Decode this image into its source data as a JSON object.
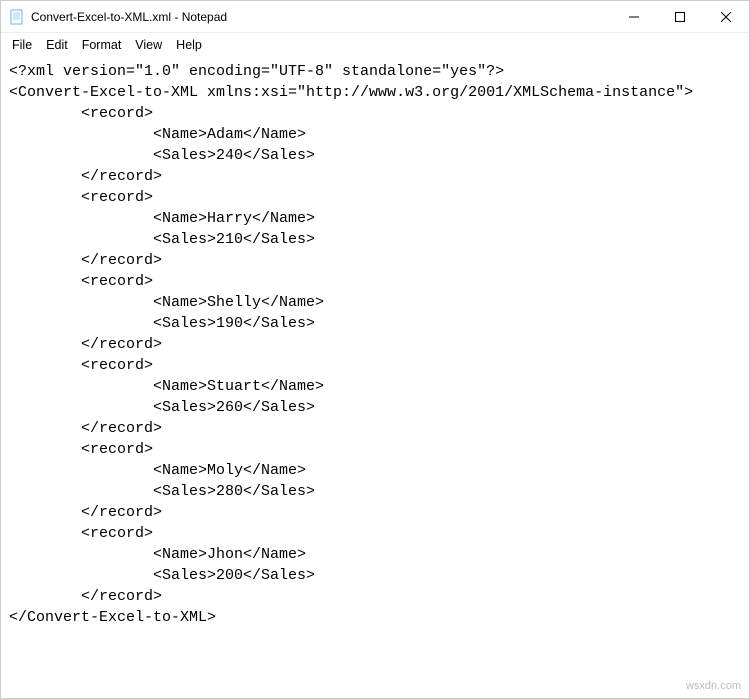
{
  "window": {
    "title": "Convert-Excel-to-XML.xml - Notepad"
  },
  "menu": {
    "file": "File",
    "edit": "Edit",
    "format": "Format",
    "view": "View",
    "help": "Help"
  },
  "xml": {
    "declaration": "<?xml version=\"1.0\" encoding=\"UTF-8\" standalone=\"yes\"?>",
    "root_open": "<Convert-Excel-to-XML xmlns:xsi=\"http://www.w3.org/2001/XMLSchema-instance\">",
    "root_close": "</Convert-Excel-to-XML>",
    "tag_record_open": "<record>",
    "tag_record_close": "</record>",
    "records": [
      {
        "name_line": "<Name>Adam</Name>",
        "sales_line": "<Sales>240</Sales>"
      },
      {
        "name_line": "<Name>Harry</Name>",
        "sales_line": "<Sales>210</Sales>"
      },
      {
        "name_line": "<Name>Shelly</Name>",
        "sales_line": "<Sales>190</Sales>"
      },
      {
        "name_line": "<Name>Stuart</Name>",
        "sales_line": "<Sales>260</Sales>"
      },
      {
        "name_line": "<Name>Moly</Name>",
        "sales_line": "<Sales>280</Sales>"
      },
      {
        "name_line": "<Name>Jhon</Name>",
        "sales_line": "<Sales>200</Sales>"
      }
    ]
  },
  "watermark": "wsxdn.com"
}
